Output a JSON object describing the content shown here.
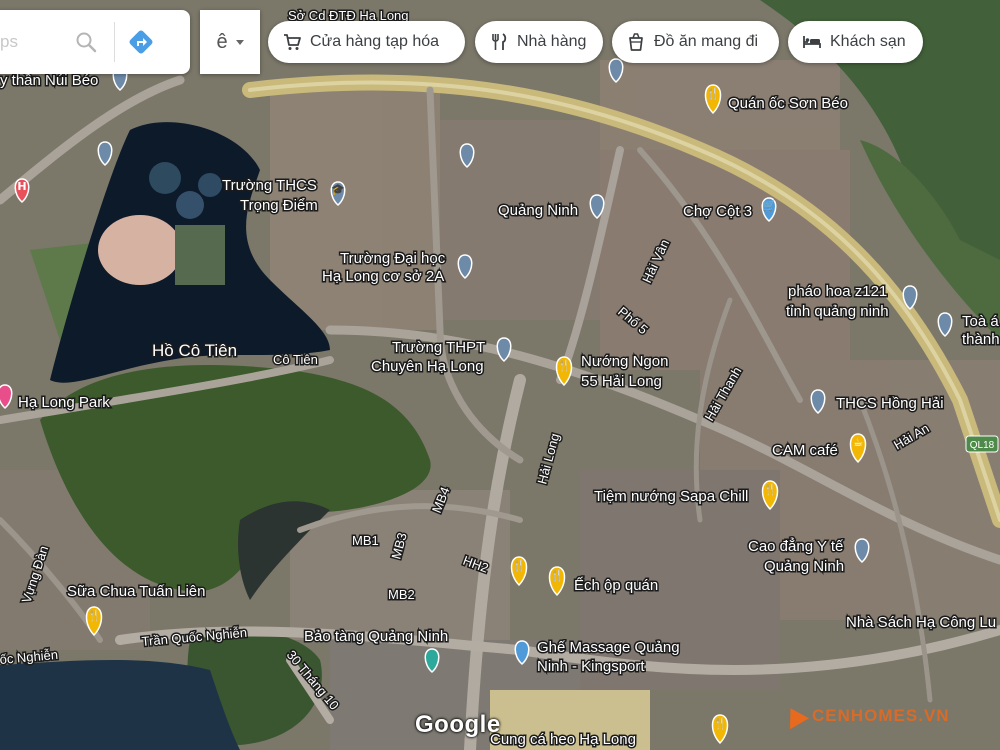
{
  "search": {
    "placeholder": "ps",
    "search_icon": "search-icon",
    "directions_icon": "directions-icon"
  },
  "language": {
    "label": "ê",
    "caret_icon": "caret-down-icon"
  },
  "chips": [
    {
      "label": "Cửa hàng tạp hóa",
      "icon": "cart-icon"
    },
    {
      "label": "Nhà hàng",
      "icon": "restaurant-icon"
    },
    {
      "label": "Đồ ăn mang đi",
      "icon": "takeout-icon"
    },
    {
      "label": "Khách sạn",
      "icon": "hotel-icon"
    }
  ],
  "places": {
    "p_top": "Sở Cd ĐTĐ Hạ Long",
    "nui_beo": "y thần Núi Béo",
    "oc_son_beo": "Quán ốc Sơn Béo",
    "thcs_trong_diem_1": "Trường THCS",
    "thcs_trong_diem_2": "Trọng Điểm",
    "quang_ninh": "Quảng Ninh",
    "cho_cot3": "Chợ Cột 3",
    "dh_ha_long_1": "Trường Đại học",
    "dh_ha_long_2": "Hạ Long cơ sở 2A",
    "phao_hoa_1": "pháo hoa z121",
    "phao_hoa_2": "tỉnh quảng ninh",
    "toa_1": "Toà á",
    "toa_2": "thành",
    "ho_co_tien": "Hồ Cô Tiên",
    "co_tien": "Cô Tiên",
    "thpt_1": "Trường THPT",
    "thpt_2": "Chuyên Hạ Long",
    "nuong_ngon_1": "Nướng Ngon",
    "nuong_ngon_2": "55 Hải Long",
    "ha_long_park": "Hạ Long Park",
    "thcs_hong_hai": "THCS Hồng Hải",
    "cam_cafe": "CAM café",
    "sapa_chill": "Tiệm nướng Sapa Chill",
    "cd_yte_1": "Cao đẳng Y tế",
    "cd_yte_2": "Quảng Ninh",
    "sua_chua": "Sữa Chua Tuấn Liên",
    "ech_op": "Ếch ộp quán",
    "nha_sach": "Nhà Sách Hạ Công Lu",
    "bao_tang": "Bảo tàng Quảng Ninh",
    "ghe_massage_1": "Ghế Massage Quảng",
    "ghe_massage_2": "Ninh - Kingsport",
    "cung_ca_heo": "Cung cá heo Hạ Long"
  },
  "roads": {
    "hai_van": "Hải Vân",
    "pho5": "Phố 5",
    "hai_thanh": "Hải Thanh",
    "hai_an": "Hải An",
    "ql18": "QL18",
    "hai_long": "Hải Long",
    "mb4": "MB4",
    "mb1": "MB1",
    "mb3": "MB3",
    "hh2": "HH2",
    "mb2": "MB2",
    "vung_dan": "Vựng Đàn",
    "tran_quoc_nghien": "Trần Quốc Nghiễn",
    "oc_nghien": "ốc Nghiễn",
    "ba_muoi_thang_muoi": "30 Tháng 10"
  },
  "branding": {
    "google": "Google",
    "watermark": "CENHOMES.VN"
  },
  "colors": {
    "restaurant_pin": "#f2b705",
    "poi_pin": "#6d8aa8",
    "hospital_pin": "#e8505b",
    "park_pin": "#e84e8a",
    "highway": "#cfc27a",
    "water": "#0d1a2a"
  }
}
